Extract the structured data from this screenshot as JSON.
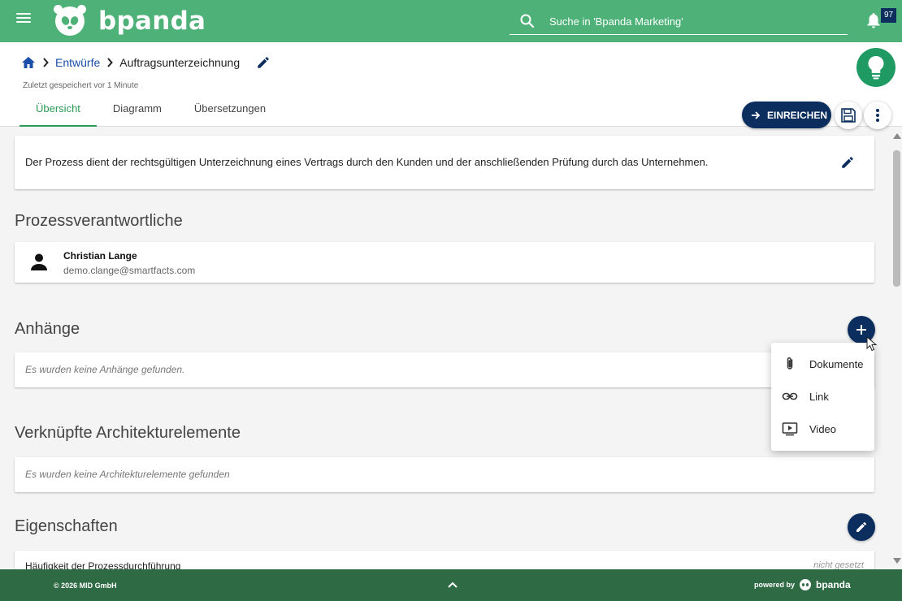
{
  "topbar": {
    "brand": "bpanda",
    "search_placeholder": "Suche in 'Bpanda Marketing'",
    "notification_count": "97"
  },
  "breadcrumb": {
    "items": [
      "Entwürfe",
      "Auftragsunterzeichnung"
    ],
    "saved_text": "Zuletzt gespeichert vor 1 Minute"
  },
  "tabs": [
    "Übersicht",
    "Diagramm",
    "Übersetzungen"
  ],
  "actions": {
    "submit_label": "EINREICHEN"
  },
  "description": "Der Prozess dient der rechtsgültigen Unterzeichnung eines Vertrags durch den Kunden und der anschließenden Prüfung durch das Unternehmen.",
  "sections": {
    "owners_title": "Prozessverantwortliche",
    "attachments_title": "Anhänge",
    "attachments_empty": "Es wurden keine Anhänge gefunden.",
    "architecture_title": "Verknüpfte Architekturelemente",
    "architecture_empty": "Es wurden keine Architekturelemente gefunden",
    "properties_title": "Eigenschaften"
  },
  "owner": {
    "name": "Christian Lange",
    "email": "demo.clange@smartfacts.com"
  },
  "properties": [
    {
      "label": "Häufigkeit der Prozessdurchführung",
      "value": "nicht gesetzt"
    }
  ],
  "attach_menu": {
    "items": [
      {
        "label": "Dokumente",
        "icon": "paperclip-icon"
      },
      {
        "label": "Link",
        "icon": "link-icon"
      },
      {
        "label": "Video",
        "icon": "video-icon"
      }
    ]
  },
  "footer": {
    "copyright": "© 2026 MID GmbH",
    "powered_by": "powered by",
    "brand": "bpanda"
  },
  "colors": {
    "topbar": "#4db178",
    "primary": "#0b2e5e",
    "accent_green": "#2b9a55",
    "footer": "#2e6b45"
  }
}
